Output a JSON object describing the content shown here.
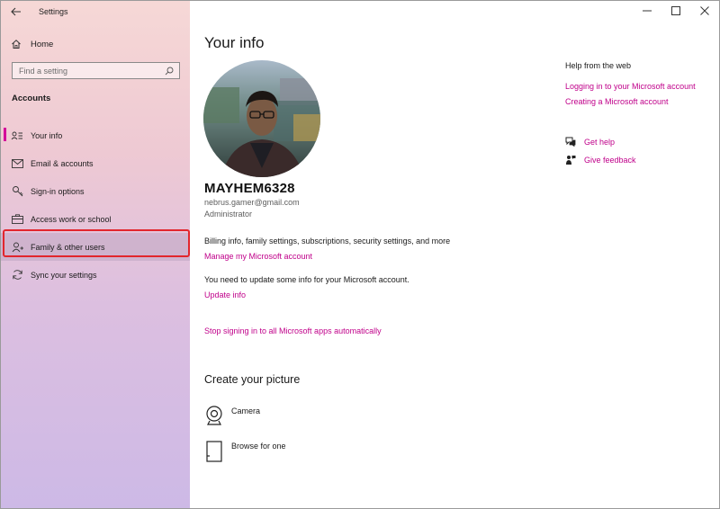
{
  "window": {
    "title": "Settings",
    "controls": {
      "minimize": "—",
      "maximize": "☐",
      "close": "✕"
    }
  },
  "sidebar": {
    "back_icon": "back-arrow-icon",
    "home_label": "Home",
    "search_placeholder": "Find a setting",
    "section_header": "Accounts",
    "items": [
      {
        "label": "Your info",
        "icon": "person-card-icon",
        "active": true
      },
      {
        "label": "Email & accounts",
        "icon": "mail-icon"
      },
      {
        "label": "Sign-in options",
        "icon": "key-icon"
      },
      {
        "label": "Access work or school",
        "icon": "briefcase-icon"
      },
      {
        "label": "Family & other users",
        "icon": "person-add-icon",
        "highlighted": true
      },
      {
        "label": "Sync your settings",
        "icon": "sync-icon"
      }
    ]
  },
  "main": {
    "title": "Your info",
    "user": {
      "name": "MAYHEM6328",
      "email": "nebrus.gamer@gmail.com",
      "role": "Administrator"
    },
    "billing_text": "Billing info, family settings, subscriptions, security settings, and more",
    "manage_link": "Manage my Microsoft account",
    "update_text": "You need to update some info for your Microsoft account.",
    "update_link": "Update info",
    "stop_link": "Stop signing in to all Microsoft apps automatically",
    "picture_header": "Create your picture",
    "picture_options": [
      {
        "label": "Camera",
        "icon": "camera-icon"
      },
      {
        "label": "Browse for one",
        "icon": "browse-file-icon"
      }
    ]
  },
  "help": {
    "title": "Help from the web",
    "links": [
      "Logging in to your Microsoft account",
      "Creating a Microsoft account"
    ],
    "get_help": "Get help",
    "give_feedback": "Give feedback"
  },
  "colors": {
    "accent": "#c0008a",
    "active_indicator": "#d4009a",
    "highlight_border": "#e2262d"
  }
}
